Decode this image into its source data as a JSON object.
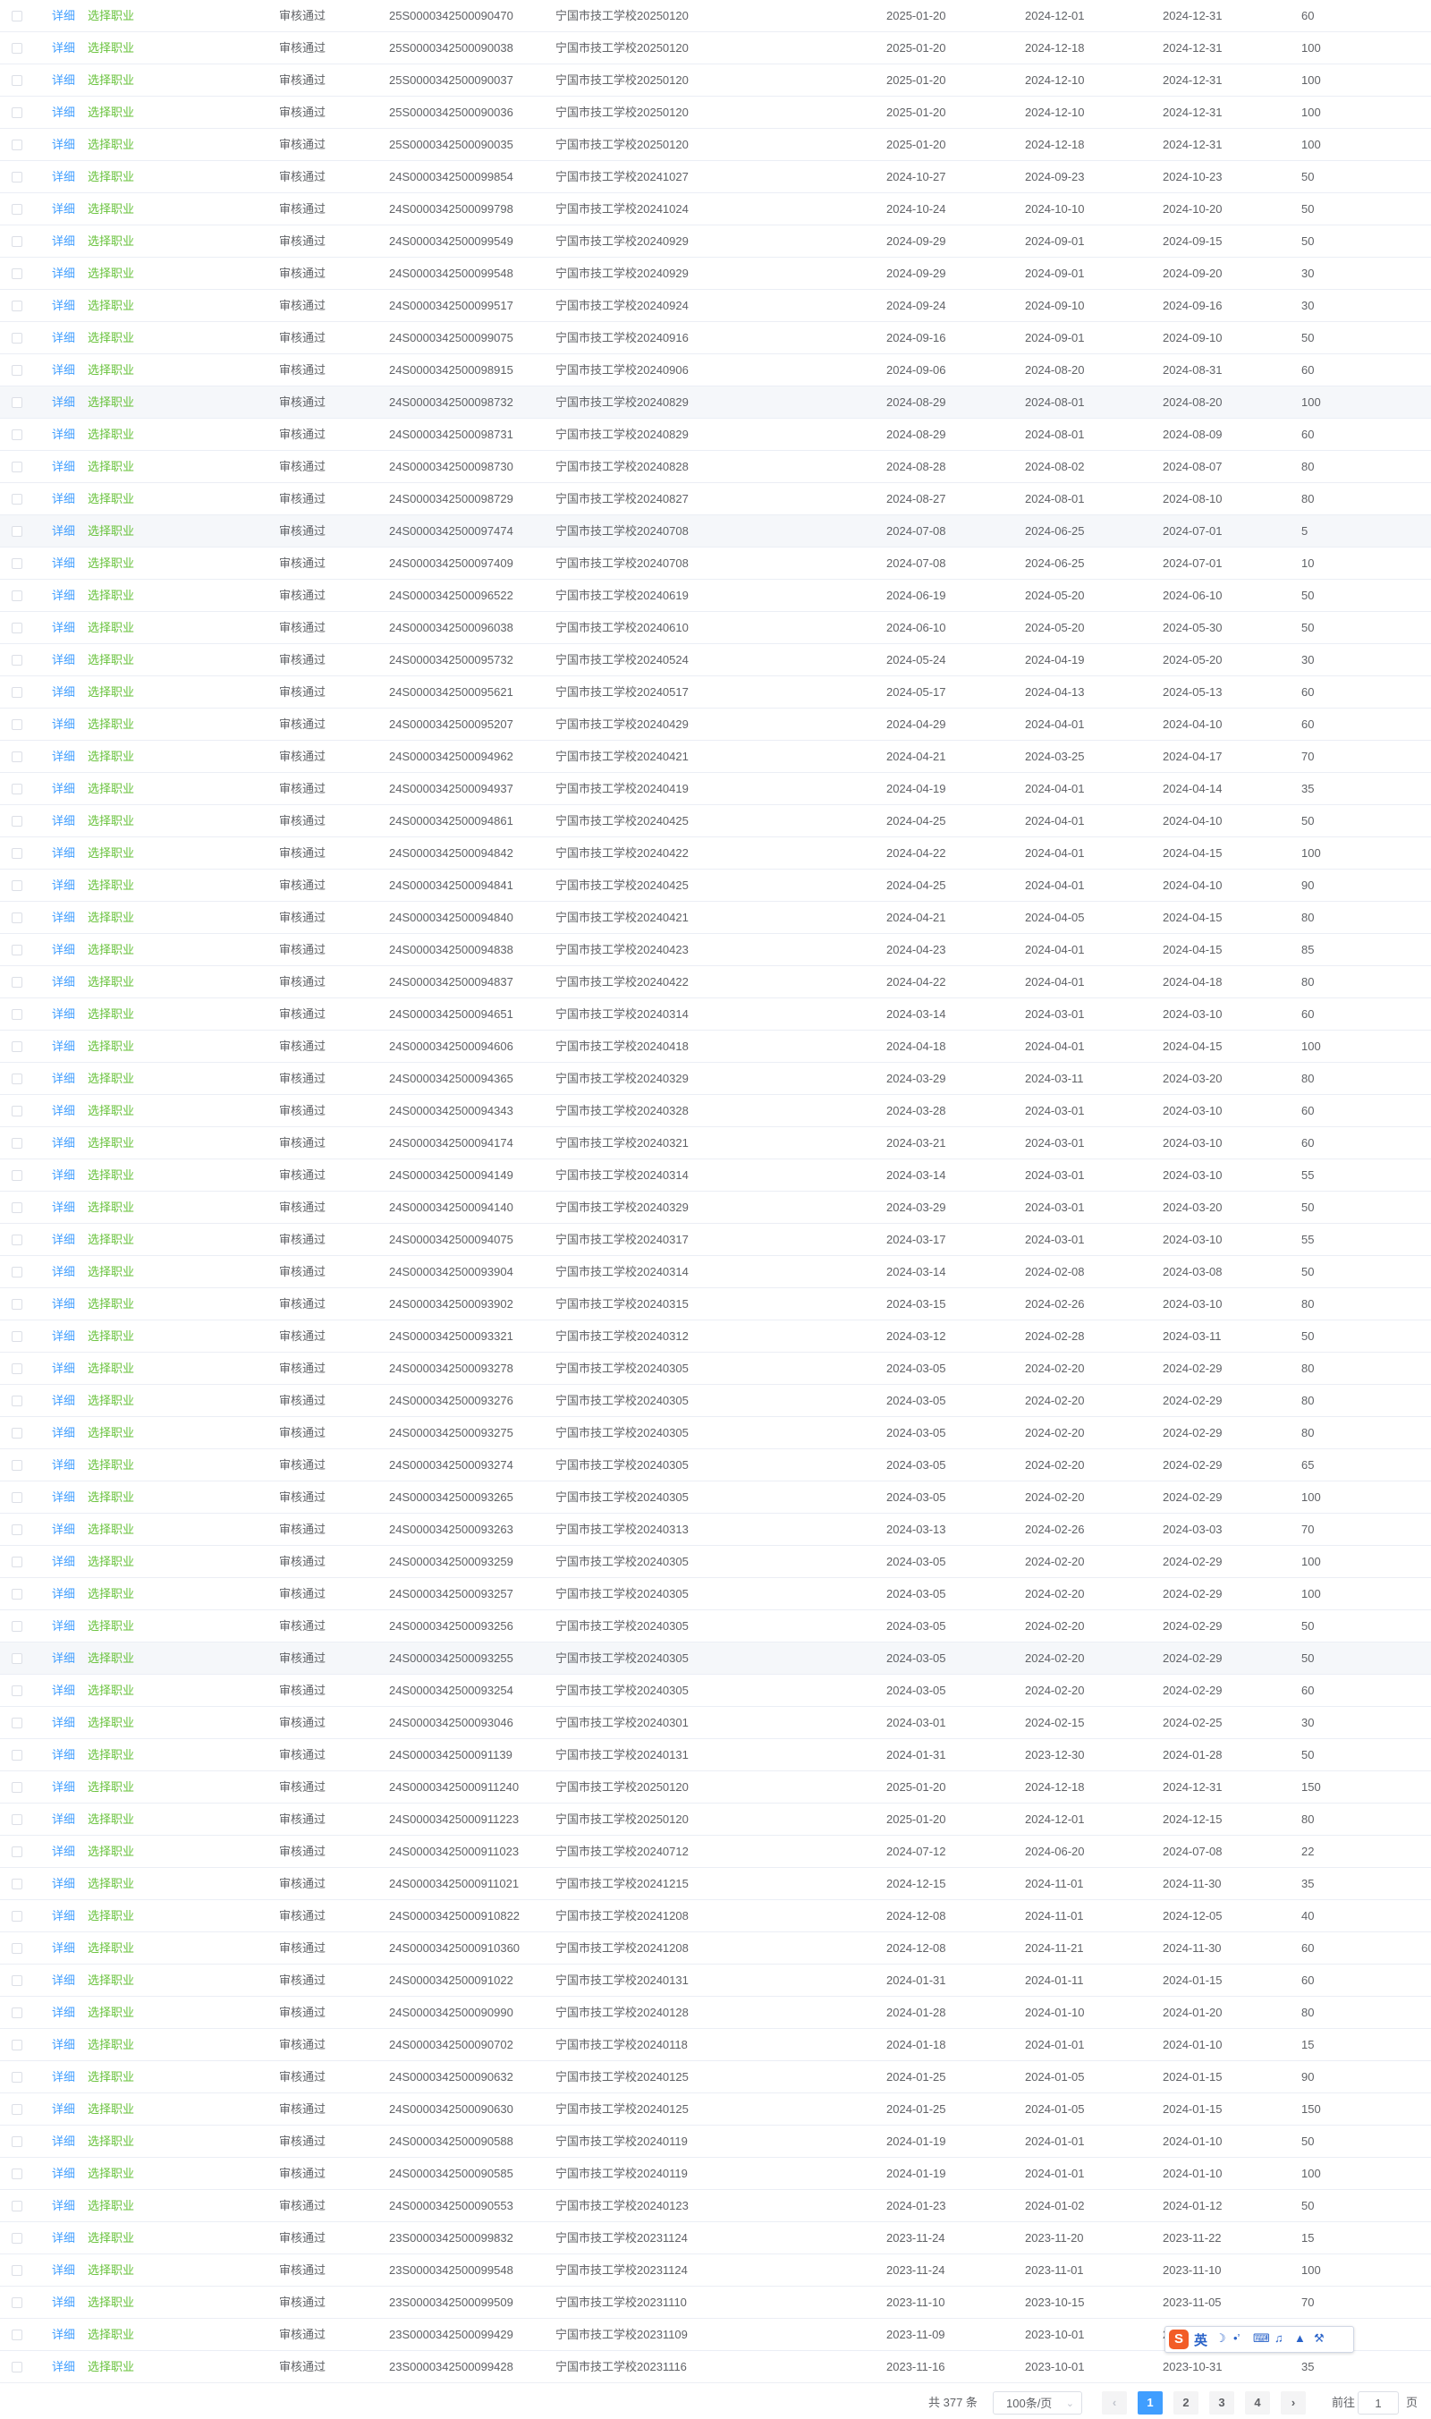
{
  "table": {
    "actions": {
      "detail": "详细",
      "choose": "选择职业"
    },
    "rows": [
      {
        "status": "审核通过",
        "code": "25S0000342500090470",
        "plan": "宁国市技工学校20250120",
        "d1": "2025-01-20",
        "d2": "2024-12-01",
        "d3": "2024-12-31",
        "count": "60"
      },
      {
        "status": "审核通过",
        "code": "25S0000342500090038",
        "plan": "宁国市技工学校20250120",
        "d1": "2025-01-20",
        "d2": "2024-12-18",
        "d3": "2024-12-31",
        "count": "100"
      },
      {
        "status": "审核通过",
        "code": "25S0000342500090037",
        "plan": "宁国市技工学校20250120",
        "d1": "2025-01-20",
        "d2": "2024-12-10",
        "d3": "2024-12-31",
        "count": "100"
      },
      {
        "status": "审核通过",
        "code": "25S0000342500090036",
        "plan": "宁国市技工学校20250120",
        "d1": "2025-01-20",
        "d2": "2024-12-10",
        "d3": "2024-12-31",
        "count": "100"
      },
      {
        "status": "审核通过",
        "code": "25S0000342500090035",
        "plan": "宁国市技工学校20250120",
        "d1": "2025-01-20",
        "d2": "2024-12-18",
        "d3": "2024-12-31",
        "count": "100"
      },
      {
        "status": "审核通过",
        "code": "24S0000342500099854",
        "plan": "宁国市技工学校20241027",
        "d1": "2024-10-27",
        "d2": "2024-09-23",
        "d3": "2024-10-23",
        "count": "50"
      },
      {
        "status": "审核通过",
        "code": "24S0000342500099798",
        "plan": "宁国市技工学校20241024",
        "d1": "2024-10-24",
        "d2": "2024-10-10",
        "d3": "2024-10-20",
        "count": "50"
      },
      {
        "status": "审核通过",
        "code": "24S0000342500099549",
        "plan": "宁国市技工学校20240929",
        "d1": "2024-09-29",
        "d2": "2024-09-01",
        "d3": "2024-09-15",
        "count": "50"
      },
      {
        "status": "审核通过",
        "code": "24S0000342500099548",
        "plan": "宁国市技工学校20240929",
        "d1": "2024-09-29",
        "d2": "2024-09-01",
        "d3": "2024-09-20",
        "count": "30"
      },
      {
        "status": "审核通过",
        "code": "24S0000342500099517",
        "plan": "宁国市技工学校20240924",
        "d1": "2024-09-24",
        "d2": "2024-09-10",
        "d3": "2024-09-16",
        "count": "30"
      },
      {
        "status": "审核通过",
        "code": "24S0000342500099075",
        "plan": "宁国市技工学校20240916",
        "d1": "2024-09-16",
        "d2": "2024-09-01",
        "d3": "2024-09-10",
        "count": "50"
      },
      {
        "status": "审核通过",
        "code": "24S0000342500098915",
        "plan": "宁国市技工学校20240906",
        "d1": "2024-09-06",
        "d2": "2024-08-20",
        "d3": "2024-08-31",
        "count": "60"
      },
      {
        "status": "审核通过",
        "code": "24S0000342500098732",
        "plan": "宁国市技工学校20240829",
        "d1": "2024-08-29",
        "d2": "2024-08-01",
        "d3": "2024-08-20",
        "count": "100"
      },
      {
        "status": "审核通过",
        "code": "24S0000342500098731",
        "plan": "宁国市技工学校20240829",
        "d1": "2024-08-29",
        "d2": "2024-08-01",
        "d3": "2024-08-09",
        "count": "60"
      },
      {
        "status": "审核通过",
        "code": "24S0000342500098730",
        "plan": "宁国市技工学校20240828",
        "d1": "2024-08-28",
        "d2": "2024-08-02",
        "d3": "2024-08-07",
        "count": "80"
      },
      {
        "status": "审核通过",
        "code": "24S0000342500098729",
        "plan": "宁国市技工学校20240827",
        "d1": "2024-08-27",
        "d2": "2024-08-01",
        "d3": "2024-08-10",
        "count": "80"
      },
      {
        "status": "审核通过",
        "code": "24S0000342500097474",
        "plan": "宁国市技工学校20240708",
        "d1": "2024-07-08",
        "d2": "2024-06-25",
        "d3": "2024-07-01",
        "count": "5"
      },
      {
        "status": "审核通过",
        "code": "24S0000342500097409",
        "plan": "宁国市技工学校20240708",
        "d1": "2024-07-08",
        "d2": "2024-06-25",
        "d3": "2024-07-01",
        "count": "10"
      },
      {
        "status": "审核通过",
        "code": "24S0000342500096522",
        "plan": "宁国市技工学校20240619",
        "d1": "2024-06-19",
        "d2": "2024-05-20",
        "d3": "2024-06-10",
        "count": "50"
      },
      {
        "status": "审核通过",
        "code": "24S0000342500096038",
        "plan": "宁国市技工学校20240610",
        "d1": "2024-06-10",
        "d2": "2024-05-20",
        "d3": "2024-05-30",
        "count": "50"
      },
      {
        "status": "审核通过",
        "code": "24S0000342500095732",
        "plan": "宁国市技工学校20240524",
        "d1": "2024-05-24",
        "d2": "2024-04-19",
        "d3": "2024-05-20",
        "count": "30"
      },
      {
        "status": "审核通过",
        "code": "24S0000342500095621",
        "plan": "宁国市技工学校20240517",
        "d1": "2024-05-17",
        "d2": "2024-04-13",
        "d3": "2024-05-13",
        "count": "60"
      },
      {
        "status": "审核通过",
        "code": "24S0000342500095207",
        "plan": "宁国市技工学校20240429",
        "d1": "2024-04-29",
        "d2": "2024-04-01",
        "d3": "2024-04-10",
        "count": "60"
      },
      {
        "status": "审核通过",
        "code": "24S0000342500094962",
        "plan": "宁国市技工学校20240421",
        "d1": "2024-04-21",
        "d2": "2024-03-25",
        "d3": "2024-04-17",
        "count": "70"
      },
      {
        "status": "审核通过",
        "code": "24S0000342500094937",
        "plan": "宁国市技工学校20240419",
        "d1": "2024-04-19",
        "d2": "2024-04-01",
        "d3": "2024-04-14",
        "count": "35"
      },
      {
        "status": "审核通过",
        "code": "24S0000342500094861",
        "plan": "宁国市技工学校20240425",
        "d1": "2024-04-25",
        "d2": "2024-04-01",
        "d3": "2024-04-10",
        "count": "50"
      },
      {
        "status": "审核通过",
        "code": "24S0000342500094842",
        "plan": "宁国市技工学校20240422",
        "d1": "2024-04-22",
        "d2": "2024-04-01",
        "d3": "2024-04-15",
        "count": "100"
      },
      {
        "status": "审核通过",
        "code": "24S0000342500094841",
        "plan": "宁国市技工学校20240425",
        "d1": "2024-04-25",
        "d2": "2024-04-01",
        "d3": "2024-04-10",
        "count": "90"
      },
      {
        "status": "审核通过",
        "code": "24S0000342500094840",
        "plan": "宁国市技工学校20240421",
        "d1": "2024-04-21",
        "d2": "2024-04-05",
        "d3": "2024-04-15",
        "count": "80"
      },
      {
        "status": "审核通过",
        "code": "24S0000342500094838",
        "plan": "宁国市技工学校20240423",
        "d1": "2024-04-23",
        "d2": "2024-04-01",
        "d3": "2024-04-15",
        "count": "85"
      },
      {
        "status": "审核通过",
        "code": "24S0000342500094837",
        "plan": "宁国市技工学校20240422",
        "d1": "2024-04-22",
        "d2": "2024-04-01",
        "d3": "2024-04-18",
        "count": "80"
      },
      {
        "status": "审核通过",
        "code": "24S0000342500094651",
        "plan": "宁国市技工学校20240314",
        "d1": "2024-03-14",
        "d2": "2024-03-01",
        "d3": "2024-03-10",
        "count": "60"
      },
      {
        "status": "审核通过",
        "code": "24S0000342500094606",
        "plan": "宁国市技工学校20240418",
        "d1": "2024-04-18",
        "d2": "2024-04-01",
        "d3": "2024-04-15",
        "count": "100"
      },
      {
        "status": "审核通过",
        "code": "24S0000342500094365",
        "plan": "宁国市技工学校20240329",
        "d1": "2024-03-29",
        "d2": "2024-03-11",
        "d3": "2024-03-20",
        "count": "80"
      },
      {
        "status": "审核通过",
        "code": "24S0000342500094343",
        "plan": "宁国市技工学校20240328",
        "d1": "2024-03-28",
        "d2": "2024-03-01",
        "d3": "2024-03-10",
        "count": "60"
      },
      {
        "status": "审核通过",
        "code": "24S0000342500094174",
        "plan": "宁国市技工学校20240321",
        "d1": "2024-03-21",
        "d2": "2024-03-01",
        "d3": "2024-03-10",
        "count": "60"
      },
      {
        "status": "审核通过",
        "code": "24S0000342500094149",
        "plan": "宁国市技工学校20240314",
        "d1": "2024-03-14",
        "d2": "2024-03-01",
        "d3": "2024-03-10",
        "count": "55"
      },
      {
        "status": "审核通过",
        "code": "24S0000342500094140",
        "plan": "宁国市技工学校20240329",
        "d1": "2024-03-29",
        "d2": "2024-03-01",
        "d3": "2024-03-20",
        "count": "50"
      },
      {
        "status": "审核通过",
        "code": "24S0000342500094075",
        "plan": "宁国市技工学校20240317",
        "d1": "2024-03-17",
        "d2": "2024-03-01",
        "d3": "2024-03-10",
        "count": "55"
      },
      {
        "status": "审核通过",
        "code": "24S0000342500093904",
        "plan": "宁国市技工学校20240314",
        "d1": "2024-03-14",
        "d2": "2024-02-08",
        "d3": "2024-03-08",
        "count": "50"
      },
      {
        "status": "审核通过",
        "code": "24S0000342500093902",
        "plan": "宁国市技工学校20240315",
        "d1": "2024-03-15",
        "d2": "2024-02-26",
        "d3": "2024-03-10",
        "count": "80"
      },
      {
        "status": "审核通过",
        "code": "24S0000342500093321",
        "plan": "宁国市技工学校20240312",
        "d1": "2024-03-12",
        "d2": "2024-02-28",
        "d3": "2024-03-11",
        "count": "50"
      },
      {
        "status": "审核通过",
        "code": "24S0000342500093278",
        "plan": "宁国市技工学校20240305",
        "d1": "2024-03-05",
        "d2": "2024-02-20",
        "d3": "2024-02-29",
        "count": "80"
      },
      {
        "status": "审核通过",
        "code": "24S0000342500093276",
        "plan": "宁国市技工学校20240305",
        "d1": "2024-03-05",
        "d2": "2024-02-20",
        "d3": "2024-02-29",
        "count": "80"
      },
      {
        "status": "审核通过",
        "code": "24S0000342500093275",
        "plan": "宁国市技工学校20240305",
        "d1": "2024-03-05",
        "d2": "2024-02-20",
        "d3": "2024-02-29",
        "count": "80"
      },
      {
        "status": "审核通过",
        "code": "24S0000342500093274",
        "plan": "宁国市技工学校20240305",
        "d1": "2024-03-05",
        "d2": "2024-02-20",
        "d3": "2024-02-29",
        "count": "65"
      },
      {
        "status": "审核通过",
        "code": "24S0000342500093265",
        "plan": "宁国市技工学校20240305",
        "d1": "2024-03-05",
        "d2": "2024-02-20",
        "d3": "2024-02-29",
        "count": "100"
      },
      {
        "status": "审核通过",
        "code": "24S0000342500093263",
        "plan": "宁国市技工学校20240313",
        "d1": "2024-03-13",
        "d2": "2024-02-26",
        "d3": "2024-03-03",
        "count": "70"
      },
      {
        "status": "审核通过",
        "code": "24S0000342500093259",
        "plan": "宁国市技工学校20240305",
        "d1": "2024-03-05",
        "d2": "2024-02-20",
        "d3": "2024-02-29",
        "count": "100"
      },
      {
        "status": "审核通过",
        "code": "24S0000342500093257",
        "plan": "宁国市技工学校20240305",
        "d1": "2024-03-05",
        "d2": "2024-02-20",
        "d3": "2024-02-29",
        "count": "100"
      },
      {
        "status": "审核通过",
        "code": "24S0000342500093256",
        "plan": "宁国市技工学校20240305",
        "d1": "2024-03-05",
        "d2": "2024-02-20",
        "d3": "2024-02-29",
        "count": "50"
      },
      {
        "status": "审核通过",
        "code": "24S0000342500093255",
        "plan": "宁国市技工学校20240305",
        "d1": "2024-03-05",
        "d2": "2024-02-20",
        "d3": "2024-02-29",
        "count": "50"
      },
      {
        "status": "审核通过",
        "code": "24S0000342500093254",
        "plan": "宁国市技工学校20240305",
        "d1": "2024-03-05",
        "d2": "2024-02-20",
        "d3": "2024-02-29",
        "count": "60"
      },
      {
        "status": "审核通过",
        "code": "24S0000342500093046",
        "plan": "宁国市技工学校20240301",
        "d1": "2024-03-01",
        "d2": "2024-02-15",
        "d3": "2024-02-25",
        "count": "30"
      },
      {
        "status": "审核通过",
        "code": "24S0000342500091139",
        "plan": "宁国市技工学校20240131",
        "d1": "2024-01-31",
        "d2": "2023-12-30",
        "d3": "2024-01-28",
        "count": "50"
      },
      {
        "status": "审核通过",
        "code": "24S00003425000911240",
        "plan": "宁国市技工学校20250120",
        "d1": "2025-01-20",
        "d2": "2024-12-18",
        "d3": "2024-12-31",
        "count": "150"
      },
      {
        "status": "审核通过",
        "code": "24S00003425000911223",
        "plan": "宁国市技工学校20250120",
        "d1": "2025-01-20",
        "d2": "2024-12-01",
        "d3": "2024-12-15",
        "count": "80"
      },
      {
        "status": "审核通过",
        "code": "24S00003425000911023",
        "plan": "宁国市技工学校20240712",
        "d1": "2024-07-12",
        "d2": "2024-06-20",
        "d3": "2024-07-08",
        "count": "22"
      },
      {
        "status": "审核通过",
        "code": "24S00003425000911021",
        "plan": "宁国市技工学校20241215",
        "d1": "2024-12-15",
        "d2": "2024-11-01",
        "d3": "2024-11-30",
        "count": "35"
      },
      {
        "status": "审核通过",
        "code": "24S00003425000910822",
        "plan": "宁国市技工学校20241208",
        "d1": "2024-12-08",
        "d2": "2024-11-01",
        "d3": "2024-12-05",
        "count": "40"
      },
      {
        "status": "审核通过",
        "code": "24S00003425000910360",
        "plan": "宁国市技工学校20241208",
        "d1": "2024-12-08",
        "d2": "2024-11-21",
        "d3": "2024-11-30",
        "count": "60"
      },
      {
        "status": "审核通过",
        "code": "24S0000342500091022",
        "plan": "宁国市技工学校20240131",
        "d1": "2024-01-31",
        "d2": "2024-01-11",
        "d3": "2024-01-15",
        "count": "60"
      },
      {
        "status": "审核通过",
        "code": "24S0000342500090990",
        "plan": "宁国市技工学校20240128",
        "d1": "2024-01-28",
        "d2": "2024-01-10",
        "d3": "2024-01-20",
        "count": "80"
      },
      {
        "status": "审核通过",
        "code": "24S0000342500090702",
        "plan": "宁国市技工学校20240118",
        "d1": "2024-01-18",
        "d2": "2024-01-01",
        "d3": "2024-01-10",
        "count": "15"
      },
      {
        "status": "审核通过",
        "code": "24S0000342500090632",
        "plan": "宁国市技工学校20240125",
        "d1": "2024-01-25",
        "d2": "2024-01-05",
        "d3": "2024-01-15",
        "count": "90"
      },
      {
        "status": "审核通过",
        "code": "24S0000342500090630",
        "plan": "宁国市技工学校20240125",
        "d1": "2024-01-25",
        "d2": "2024-01-05",
        "d3": "2024-01-15",
        "count": "150"
      },
      {
        "status": "审核通过",
        "code": "24S0000342500090588",
        "plan": "宁国市技工学校20240119",
        "d1": "2024-01-19",
        "d2": "2024-01-01",
        "d3": "2024-01-10",
        "count": "50"
      },
      {
        "status": "审核通过",
        "code": "24S0000342500090585",
        "plan": "宁国市技工学校20240119",
        "d1": "2024-01-19",
        "d2": "2024-01-01",
        "d3": "2024-01-10",
        "count": "100"
      },
      {
        "status": "审核通过",
        "code": "24S0000342500090553",
        "plan": "宁国市技工学校20240123",
        "d1": "2024-01-23",
        "d2": "2024-01-02",
        "d3": "2024-01-12",
        "count": "50"
      },
      {
        "status": "审核通过",
        "code": "23S0000342500099832",
        "plan": "宁国市技工学校20231124",
        "d1": "2023-11-24",
        "d2": "2023-11-20",
        "d3": "2023-11-22",
        "count": "15"
      },
      {
        "status": "审核通过",
        "code": "23S0000342500099548",
        "plan": "宁国市技工学校20231124",
        "d1": "2023-11-24",
        "d2": "2023-11-01",
        "d3": "2023-11-10",
        "count": "100"
      },
      {
        "status": "审核通过",
        "code": "23S0000342500099509",
        "plan": "宁国市技工学校20231110",
        "d1": "2023-11-10",
        "d2": "2023-10-15",
        "d3": "2023-11-05",
        "count": "70"
      },
      {
        "status": "审核通过",
        "code": "23S0000342500099429",
        "plan": "宁国市技工学校20231109",
        "d1": "2023-11-09",
        "d2": "2023-10-01",
        "d3": "202",
        "count": ""
      },
      {
        "status": "审核通过",
        "code": "23S0000342500099428",
        "plan": "宁国市技工学校20231116",
        "d1": "2023-11-16",
        "d2": "2023-10-01",
        "d3": "2023-10-31",
        "count": "35"
      }
    ]
  },
  "pagination": {
    "total": "共 377 条",
    "page_size": "100条/页",
    "pages": [
      "1",
      "2",
      "3",
      "4"
    ],
    "goto_label": "前往",
    "current": "1",
    "page_suffix": "页"
  },
  "ime_toolbar": {
    "logo": "S",
    "lang": "英"
  },
  "colors": {
    "detail_link": "#409eff",
    "choose_link": "#67c23a",
    "active_page": "#409eff"
  }
}
